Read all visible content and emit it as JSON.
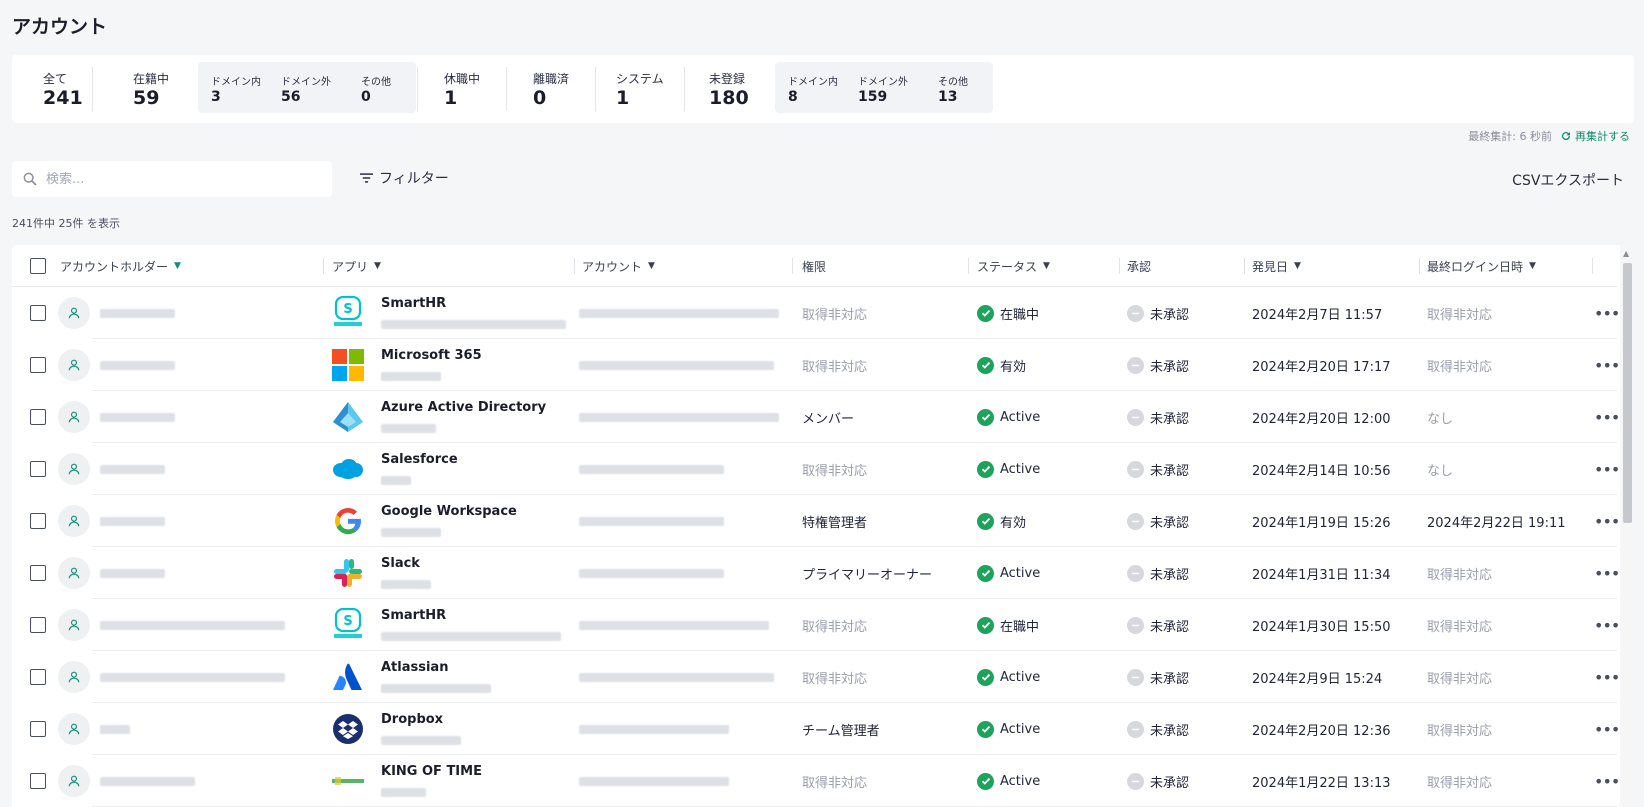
{
  "page": {
    "title": "アカウント"
  },
  "stats": {
    "all": {
      "label": "全て",
      "value": "241"
    },
    "enrolled": {
      "label": "在籍中",
      "value": "59",
      "sub": [
        {
          "label": "ドメイン内",
          "value": "3"
        },
        {
          "label": "ドメイン外",
          "value": "56"
        },
        {
          "label": "その他",
          "value": "0"
        }
      ]
    },
    "leave": {
      "label": "休職中",
      "value": "1"
    },
    "retired": {
      "label": "離職済",
      "value": "0"
    },
    "system": {
      "label": "システム",
      "value": "1"
    },
    "unregistered": {
      "label": "未登録",
      "value": "180",
      "sub": [
        {
          "label": "ドメイン内",
          "value": "8"
        },
        {
          "label": "ドメイン外",
          "value": "159"
        },
        {
          "label": "その他",
          "value": "13"
        }
      ]
    }
  },
  "recalc": {
    "last_calc": "最終集計: 6 秒前",
    "button": "再集計する"
  },
  "toolbar": {
    "search_placeholder": "検索...",
    "filter_label": "フィルター",
    "csv_label": "CSVエクスポート"
  },
  "count_text": "241件中 25件 を表示",
  "table": {
    "headers": {
      "holder": "アカウントホルダー",
      "app": "アプリ",
      "account": "アカウント",
      "role": "権限",
      "status": "ステータス",
      "approval": "承認",
      "found": "発見日",
      "last_login": "最終ログイン日時"
    },
    "rows": [
      {
        "app": "SmartHR",
        "logo": "smarthr-logo",
        "role": "取得非対応",
        "role_muted": true,
        "status": "在職中",
        "approval": "未承認",
        "found": "2024年2月7日 11:57",
        "last_login": "取得非対応",
        "login_muted": true
      },
      {
        "app": "Microsoft 365",
        "logo": "microsoft-logo",
        "role": "取得非対応",
        "role_muted": true,
        "status": "有効",
        "approval": "未承認",
        "found": "2024年2月20日 17:17",
        "last_login": "取得非対応",
        "login_muted": true
      },
      {
        "app": "Azure Active Directory",
        "logo": "azure-logo",
        "role": "メンバー",
        "role_muted": false,
        "status": "Active",
        "approval": "未承認",
        "found": "2024年2月20日 12:00",
        "last_login": "なし",
        "login_muted": true
      },
      {
        "app": "Salesforce",
        "logo": "salesforce-logo",
        "role": "取得非対応",
        "role_muted": true,
        "status": "Active",
        "approval": "未承認",
        "found": "2024年2月14日 10:56",
        "last_login": "なし",
        "login_muted": true
      },
      {
        "app": "Google Workspace",
        "logo": "google-logo",
        "role": "特権管理者",
        "role_muted": false,
        "status": "有効",
        "approval": "未承認",
        "found": "2024年1月19日 15:26",
        "last_login": "2024年2月22日 19:11",
        "login_muted": false
      },
      {
        "app": "Slack",
        "logo": "slack-logo",
        "role": "プライマリーオーナー",
        "role_muted": false,
        "status": "Active",
        "approval": "未承認",
        "found": "2024年1月31日 11:34",
        "last_login": "取得非対応",
        "login_muted": true
      },
      {
        "app": "SmartHR",
        "logo": "smarthr-logo",
        "role": "取得非対応",
        "role_muted": true,
        "status": "在職中",
        "approval": "未承認",
        "found": "2024年1月30日 15:50",
        "last_login": "取得非対応",
        "login_muted": true
      },
      {
        "app": "Atlassian",
        "logo": "atlassian-logo",
        "role": "取得非対応",
        "role_muted": true,
        "status": "Active",
        "approval": "未承認",
        "found": "2024年2月9日 15:24",
        "last_login": "取得非対応",
        "login_muted": true
      },
      {
        "app": "Dropbox",
        "logo": "dropbox-logo",
        "role": "チーム管理者",
        "role_muted": false,
        "status": "Active",
        "approval": "未承認",
        "found": "2024年2月20日 12:36",
        "last_login": "取得非対応",
        "login_muted": true
      },
      {
        "app": "KING OF TIME",
        "logo": "kingoftime-logo",
        "role": "取得非対応",
        "role_muted": true,
        "status": "Active",
        "approval": "未承認",
        "found": "2024年1月22日 13:13",
        "last_login": "取得非対応",
        "login_muted": true
      }
    ]
  },
  "colors": {
    "accent": "#12907a",
    "status_green": "#1ea35c"
  }
}
